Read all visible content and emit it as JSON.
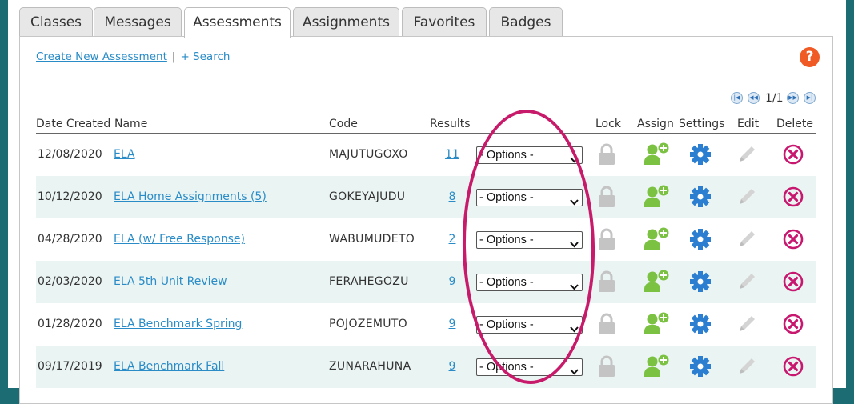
{
  "tabs": [
    {
      "label": "Classes"
    },
    {
      "label": "Messages"
    },
    {
      "label": "Assessments"
    },
    {
      "label": "Assignments"
    },
    {
      "label": "Favorites"
    },
    {
      "label": "Badges"
    }
  ],
  "active_tab": "Assessments",
  "toolbar": {
    "create_label": "Create New Assessment",
    "separator": "|",
    "search_label": "+ Search",
    "help_label": "?"
  },
  "pager": {
    "text": "1/1"
  },
  "table": {
    "headers": {
      "date": "Date Created",
      "name": "Name",
      "code": "Code",
      "results": "Results",
      "lock": "Lock",
      "assign": "Assign",
      "settings": "Settings",
      "edit": "Edit",
      "delete": "Delete"
    },
    "rows": [
      {
        "date": "12/08/2020",
        "name": "ELA",
        "code": "MAJUTUGOXO",
        "results": "11",
        "option": "- Options -"
      },
      {
        "date": "10/12/2020",
        "name": "ELA Home Assignments (5)",
        "code": "GOKEYAJUDU",
        "results": "8",
        "option": "- Options -"
      },
      {
        "date": "04/28/2020",
        "name": "ELA (w/ Free Response)",
        "code": "WABUMUDETO",
        "results": "2",
        "option": "- Options -"
      },
      {
        "date": "02/03/2020",
        "name": "ELA 5th Unit Review",
        "code": "FERAHEGOZU",
        "results": "9",
        "option": "- Options -"
      },
      {
        "date": "01/28/2020",
        "name": "ELA Benchmark Spring",
        "code": "POJOZEMUTO",
        "results": "9",
        "option": "- Options -"
      },
      {
        "date": "09/17/2019",
        "name": "ELA Benchmark Fall",
        "code": "ZUNARAHUNA",
        "results": "9",
        "option": "- Options -"
      }
    ]
  },
  "colors": {
    "background": "#1b6d73",
    "link": "#2a8cc7",
    "assign_green": "#7bc142",
    "settings_blue": "#2c7fd0",
    "delete_magenta": "#c8176f",
    "highlight_ellipse": "#c81a6a",
    "help_orange": "#f05a24"
  },
  "icons": [
    "lock-icon",
    "assign-user-plus-icon",
    "gear-icon",
    "pencil-icon",
    "delete-x-icon",
    "help-icon",
    "pager-first-icon",
    "pager-prev-icon",
    "pager-next-icon",
    "pager-last-icon"
  ]
}
